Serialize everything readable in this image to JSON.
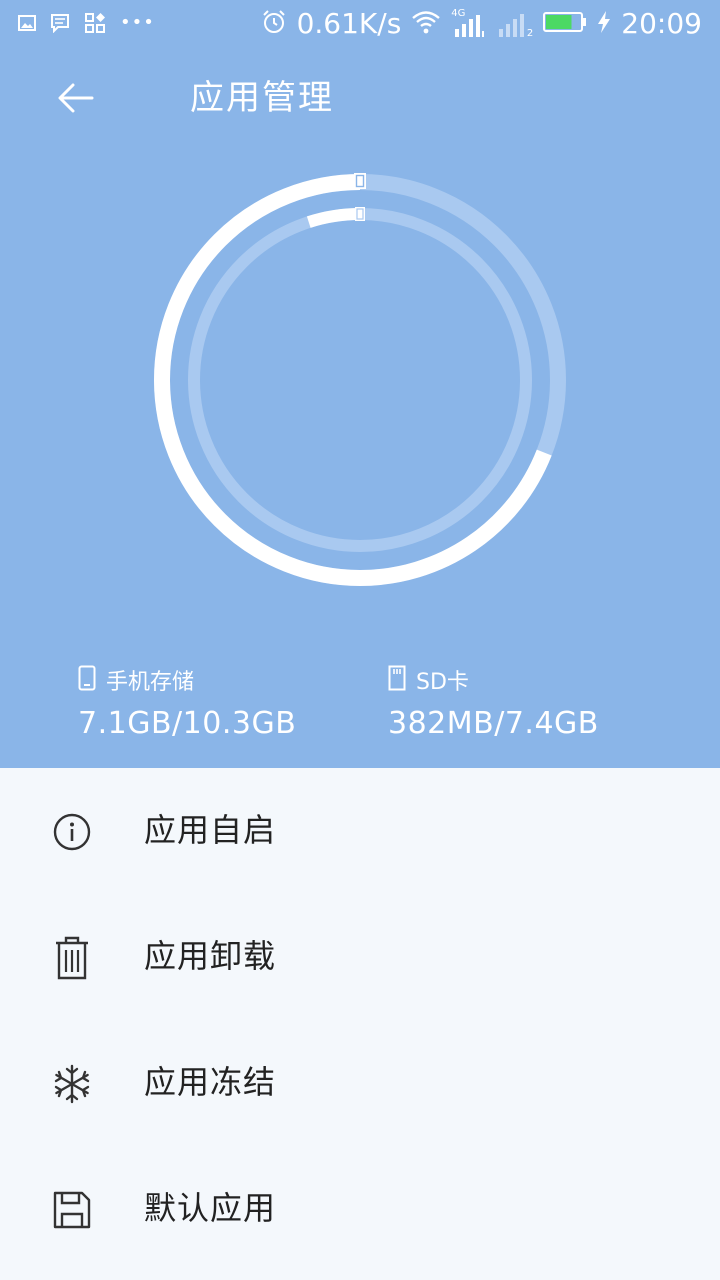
{
  "status_bar": {
    "speed": "0.61K/s",
    "network": "4G",
    "sim_slot": "2",
    "battery_level": 0.75,
    "time": "20:09"
  },
  "header": {
    "title": "应用管理",
    "back_icon": "arrow-left-icon"
  },
  "storage_chart": {
    "phone_used_fraction": 0.69,
    "sd_used_fraction": 0.05,
    "colors": {
      "used": "#ffffff",
      "remaining": "#a9c9f0",
      "background": "#8ab5e8"
    }
  },
  "storage": {
    "phone": {
      "icon": "phone-icon",
      "label": "手机存储",
      "value": "7.1GB/10.3GB"
    },
    "sd": {
      "icon": "sd-card-icon",
      "label": "SD卡",
      "value": "382MB/7.4GB"
    }
  },
  "menu": {
    "items": [
      {
        "icon": "info-icon",
        "label": "应用自启"
      },
      {
        "icon": "trash-icon",
        "label": "应用卸载"
      },
      {
        "icon": "snowflake-icon",
        "label": "应用冻结"
      },
      {
        "icon": "save-icon",
        "label": "默认应用"
      }
    ]
  }
}
